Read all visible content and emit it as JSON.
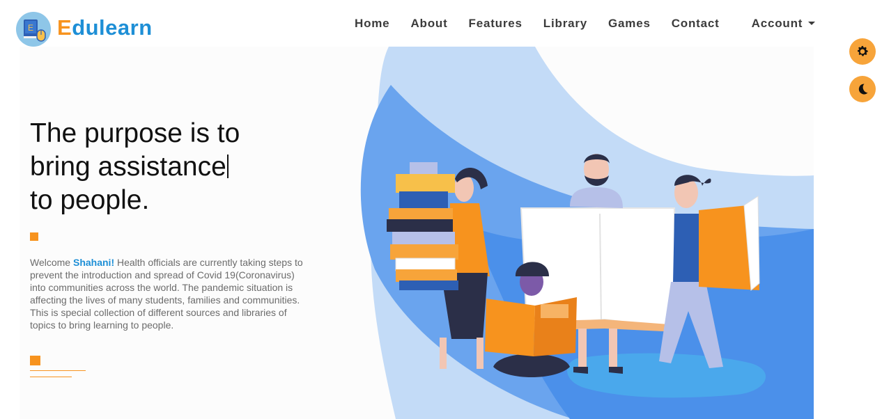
{
  "brand": {
    "first_letter": "E",
    "rest": "dulearn",
    "badge_letter": "E"
  },
  "nav": {
    "items": [
      "Home",
      "About",
      "Features",
      "Library",
      "Games",
      "Contact"
    ],
    "account_label": "Account"
  },
  "floating": {
    "settings_icon": "gear-icon",
    "theme_icon": "moon-icon"
  },
  "hero": {
    "title_line1": "The purpose is to",
    "title_line2": "bring assistance",
    "title_line3": "to people.",
    "greeting": "Welcome",
    "user_name": "Shahani!",
    "description": "Health officials are currently taking steps to prevent the introduction and spread of Covid 19(Coronavirus) into communities across the world. The pandemic situation is affecting the lives of many students, families and communities. This is special collection of different sources and libraries of topics to bring learning to people."
  },
  "colors": {
    "brand_blue": "#1e8fd6",
    "brand_orange": "#f7931e",
    "accent_button": "#f7a43a"
  }
}
